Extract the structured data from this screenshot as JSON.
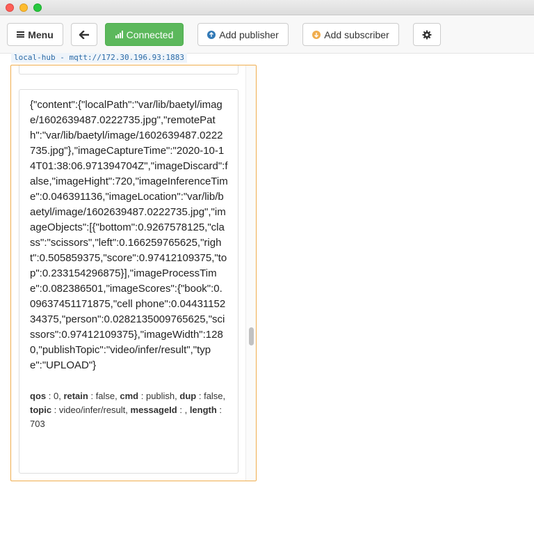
{
  "toolbar": {
    "menu_label": "Menu",
    "status_label": "Connected",
    "add_publisher_label": "Add publisher",
    "add_subscriber_label": "Add subscriber",
    "icons": {
      "menu": "hamburger-icon",
      "back": "arrow-left-icon",
      "status": "signal-icon",
      "publisher": "arrow-up-circle-icon",
      "subscriber": "arrow-down-circle-icon",
      "settings": "gear-icon"
    },
    "colors": {
      "connected": "#5cb85c",
      "publisher_icon": "#337ab7",
      "subscriber_icon": "#f0ad4e"
    }
  },
  "connection": {
    "label": "local-hub - mqtt://172.30.196.93:1883",
    "panel_border_color": "#f0ad4e"
  },
  "message": {
    "payload": "{\"content\":{\"localPath\":\"var/lib/baetyl/image/1602639487.0222735.jpg\",\"remotePath\":\"var/lib/baetyl/image/1602639487.0222735.jpg\"},\"imageCaptureTime\":\"2020-10-14T01:38:06.971394704Z\",\"imageDiscard\":false,\"imageHight\":720,\"imageInferenceTime\":0.046391136,\"imageLocation\":\"var/lib/baetyl/image/1602639487.0222735.jpg\",\"imageObjects\":[{\"bottom\":0.9267578125,\"class\":\"scissors\",\"left\":0.166259765625,\"right\":0.505859375,\"score\":0.97412109375,\"top\":0.233154296875}],\"imageProcessTime\":0.082386501,\"imageScores\":{\"book\":0.09637451171875,\"cell phone\":0.0443115234375,\"person\":0.0282135009765625,\"scissors\":0.97412109375},\"imageWidth\":1280,\"publishTopic\":\"video/infer/result\",\"type\":\"UPLOAD\"}",
    "meta": [
      {
        "key": "qos",
        "value": "0"
      },
      {
        "key": "retain",
        "value": "false"
      },
      {
        "key": "cmd",
        "value": "publish"
      },
      {
        "key": "dup",
        "value": "false"
      },
      {
        "key": "topic",
        "value": "video/infer/result"
      },
      {
        "key": "messageId",
        "value": ""
      },
      {
        "key": "length",
        "value": "703"
      }
    ]
  }
}
